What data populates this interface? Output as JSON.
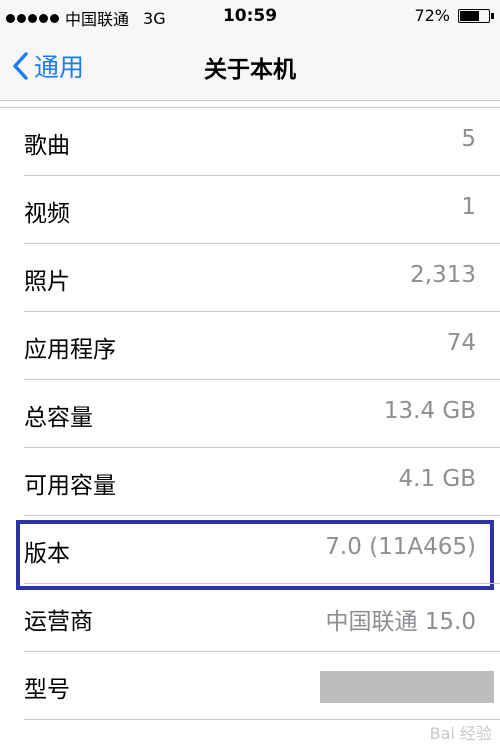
{
  "status_bar": {
    "carrier": "中国联通",
    "network": "3G",
    "time": "10:59",
    "battery_percent": "72%",
    "battery_level": 0.72
  },
  "nav": {
    "back_label": "通用",
    "title": "关于本机"
  },
  "rows": [
    {
      "label": "歌曲",
      "value": "5"
    },
    {
      "label": "视频",
      "value": "1"
    },
    {
      "label": "照片",
      "value": "2,313"
    },
    {
      "label": "应用程序",
      "value": "74"
    },
    {
      "label": "总容量",
      "value": "13.4 GB"
    },
    {
      "label": "可用容量",
      "value": "4.1 GB"
    },
    {
      "label": "版本",
      "value": "7.0 (11A465)"
    },
    {
      "label": "运营商",
      "value": "中国联通 15.0"
    },
    {
      "label": "型号",
      "value": ""
    }
  ],
  "watermark": "Bai 经验"
}
